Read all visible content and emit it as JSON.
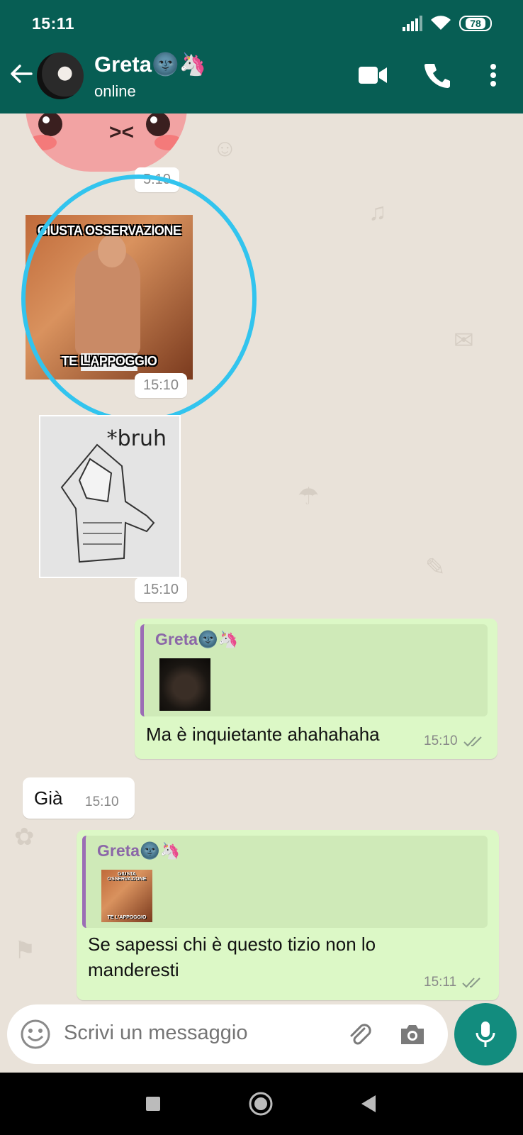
{
  "status_bar": {
    "time": "15:11",
    "battery": "78"
  },
  "header": {
    "contact_name": "Greta🌚🦄",
    "contact_status": "online"
  },
  "icons": {
    "back": "arrow-left-icon",
    "video": "video-camera-icon",
    "call": "phone-icon",
    "menu": "more-vert-icon",
    "emoji": "emoji-icon",
    "attach": "paperclip-icon",
    "camera": "camera-icon",
    "mic": "microphone-icon"
  },
  "colors": {
    "header": "#075e54",
    "outgoing_bubble": "#dcf8c6",
    "incoming_bubble": "#ffffff",
    "highlight_circle": "#32c4ee",
    "mic_button": "#128c7e"
  },
  "messages": {
    "sticker_1_time": "5:10",
    "meme_top": "GIUSTA OSSERVAZIONE",
    "meme_bottom": "TE L'APPOGGIO",
    "meme_time": "15:10",
    "bruh_text": "*bruh",
    "bruh_time": "15:10",
    "reply_1": {
      "quoted_name": "Greta🌚🦄",
      "text": "Ma è inquietante ahahahaha",
      "time": "15:10"
    },
    "incoming_1": {
      "text": "Già",
      "time": "15:10"
    },
    "reply_2": {
      "quoted_name": "Greta🌚🦄",
      "quoted_top": "GIUSTA OSSERVAZIONE",
      "quoted_bottom": "TE L'APPOGGIO",
      "text_line1": "Se sapessi chi è questo tizio non lo",
      "text_line2": "manderesti",
      "time": "15:11"
    }
  },
  "input": {
    "placeholder": "Scrivi un messaggio"
  }
}
